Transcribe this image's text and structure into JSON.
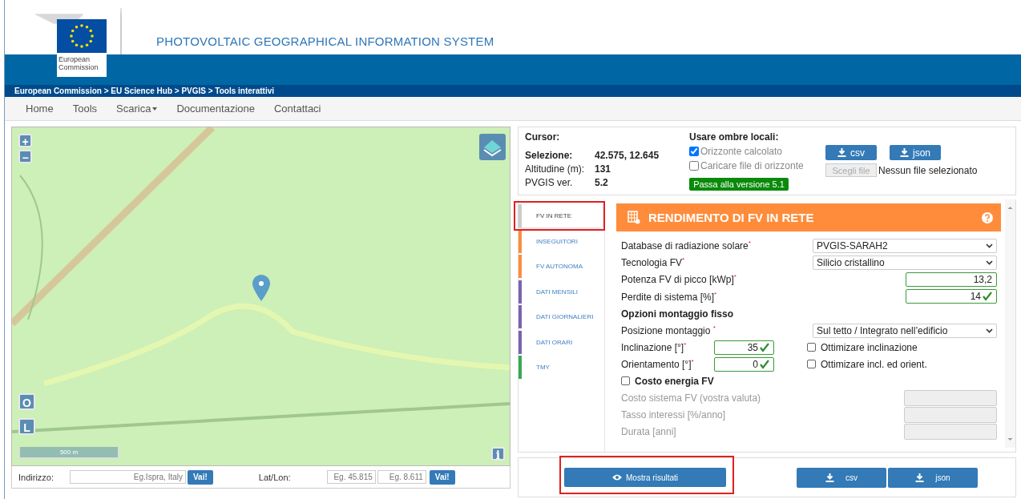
{
  "header": {
    "logo_text": "European Commission",
    "title": "PHOTOVOLTAIC GEOGRAPHICAL INFORMATION SYSTEM"
  },
  "breadcrumb": "European Commission > EU Science Hub > PVGIS > Tools interattivi",
  "nav": [
    {
      "label": "Home",
      "dropdown": false
    },
    {
      "label": "Tools",
      "dropdown": false
    },
    {
      "label": "Scarica",
      "dropdown": true
    },
    {
      "label": "Documentazione",
      "dropdown": false
    },
    {
      "label": "Contattaci",
      "dropdown": false
    }
  ],
  "map": {
    "scale": "500 m",
    "layer_buttons": [
      "O",
      "L"
    ],
    "info": "i",
    "zoom_in": "+",
    "zoom_out": "−"
  },
  "address_bar": {
    "address_label": "Indirizzo:",
    "address_placeholder": "Eg.Ispra, Italy",
    "go": "Vai!",
    "latlon_label": "Lat/Lon:",
    "lat_placeholder": "Eg. 45.815",
    "lon_placeholder": "Eg. 8.611",
    "go2": "Vai!"
  },
  "info": {
    "cursor": "Cursor:",
    "rows": [
      {
        "label": "Selezione:",
        "value": "42.575, 12.645",
        "bold": true
      },
      {
        "label": "Altitudine (m):",
        "value": "131",
        "bold": false
      },
      {
        "label": "PVGIS ver.",
        "value": "5.2",
        "bold": false
      }
    ],
    "shade_title": "Usare ombre locali:",
    "options": [
      {
        "label": "Orizzonte calcolato",
        "checked": true
      },
      {
        "label": "Caricare file di orizzonte",
        "checked": false
      }
    ],
    "version_button": "Passa alla versione 5.1",
    "downloads": [
      "csv",
      "json"
    ],
    "file_button": "Scegli file",
    "file_status": "Nessun file selezionato"
  },
  "tabs": [
    {
      "label": "FV IN RETE",
      "selected": true,
      "color": "#cccccc"
    },
    {
      "label": "INSEGUITORI",
      "selected": false,
      "color": "#ff8c3b"
    },
    {
      "label": "FV AUTONOMA",
      "selected": false,
      "color": "#ff8c3b"
    },
    {
      "label": "DATI MENSILI",
      "selected": false,
      "color": "#7a63b0"
    },
    {
      "label": "DATI GIORNALIERI",
      "selected": false,
      "color": "#7a63b0"
    },
    {
      "label": "DATI ORARI",
      "selected": false,
      "color": "#7a63b0"
    },
    {
      "label": "TMY",
      "selected": false,
      "color": "#3aa856"
    }
  ],
  "panel": {
    "title": "RENDIMENTO DI FV IN RETE",
    "rows": [
      {
        "kind": "select",
        "label": "Database di radiazione solare$^{*}$",
        "value": "PVGIS-SARAH2"
      },
      {
        "kind": "select",
        "label": "Tecnologia FV$^{*}$",
        "value": "Silicio cristallino"
      },
      {
        "kind": "number",
        "label": "Potenza FV di picco [kWp]$^{*}$",
        "value": "13,2",
        "valid": false
      },
      {
        "kind": "number",
        "label": "Perdite di sistema [%]$^{*}$",
        "value": "14",
        "valid": true
      },
      {
        "kind": "heading",
        "label": "Opzioni montaggio fisso"
      },
      {
        "kind": "select",
        "label": "Posizione montaggio $^{*}$",
        "value": "Sul tetto / Integrato nell’edificio"
      },
      {
        "kind": "angle",
        "label": "Inclinazione [°]$^{*}$",
        "value": "35",
        "valid": true,
        "option": "Ottimizare inclinazione",
        "checked": false
      },
      {
        "kind": "angle",
        "label": "Orientamento [°]$^{*}$",
        "value": "0",
        "valid": true,
        "option": "Ottimizare incl. ed orient.",
        "checked": false
      },
      {
        "kind": "checkbox",
        "label": "Costo energia FV",
        "checked": false
      },
      {
        "kind": "disabled",
        "label": "Costo sistema FV (vostra valuta)"
      },
      {
        "kind": "disabled",
        "label": "Tasso interessi [%/anno]"
      },
      {
        "kind": "disabled",
        "label": "Durata [anni]"
      }
    ]
  },
  "footer": {
    "show_button": "Mostra risultati",
    "downloads": [
      "csv",
      "json"
    ]
  }
}
